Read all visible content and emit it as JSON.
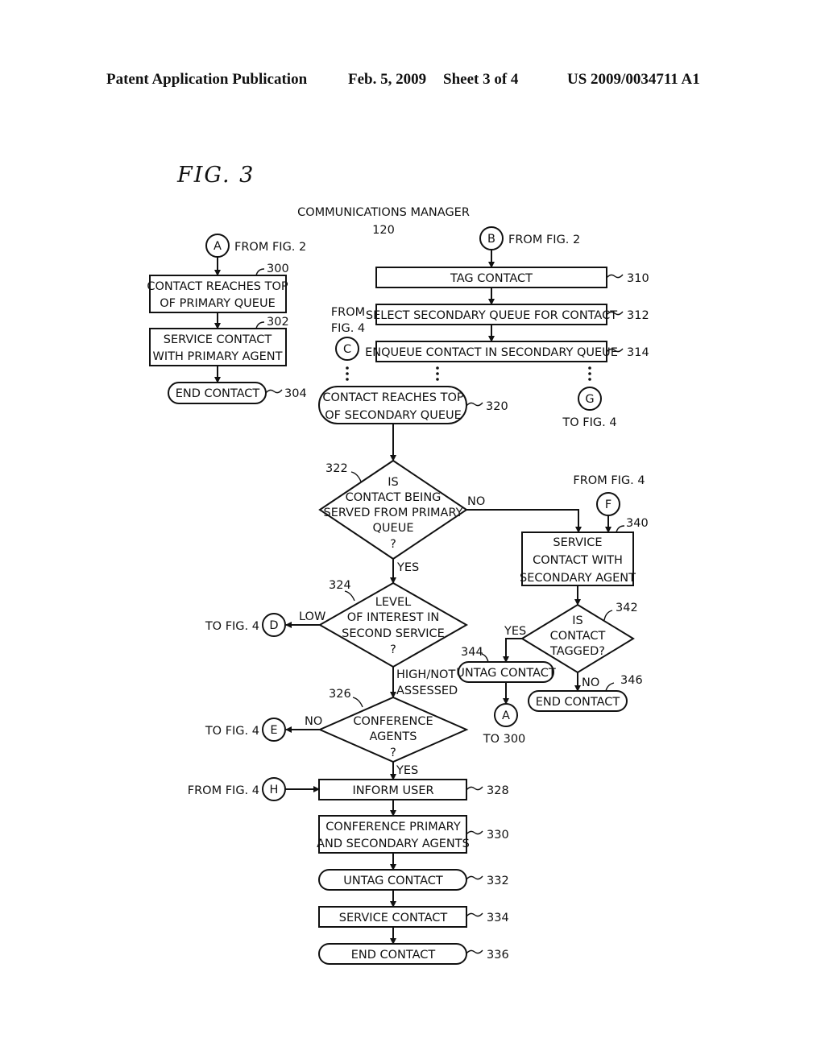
{
  "header": {
    "publication": "Patent Application Publication",
    "date": "Feb. 5, 2009",
    "sheet": "Sheet 3 of 4",
    "patent_number": "US 2009/0034711 A1"
  },
  "figure": {
    "title": "FIG.  3",
    "subtitle_line1": "COMMUNICATIONS MANAGER",
    "subtitle_line2": "120"
  },
  "connectors": {
    "A_top": {
      "letter": "A",
      "label": "FROM FIG. 2"
    },
    "B": {
      "letter": "B",
      "label": "FROM FIG. 2"
    },
    "C": {
      "letter": "C",
      "label_line1": "FROM",
      "label_line2": "FIG. 4"
    },
    "G": {
      "letter": "G",
      "label": "TO FIG. 4"
    },
    "F": {
      "letter": "F",
      "label": "FROM FIG. 4"
    },
    "D": {
      "letter": "D",
      "label": "TO FIG. 4"
    },
    "E": {
      "letter": "E",
      "label": "TO FIG. 4"
    },
    "H": {
      "letter": "H",
      "label": "FROM FIG. 4"
    },
    "A_bottom": {
      "letter": "A",
      "label": "TO 300"
    }
  },
  "steps": {
    "s300": {
      "ref": "300",
      "line1": "CONTACT REACHES TOP",
      "line2": "OF PRIMARY QUEUE"
    },
    "s302": {
      "ref": "302",
      "line1": "SERVICE CONTACT",
      "line2": "WITH PRIMARY AGENT"
    },
    "s304": {
      "ref": "304",
      "line1": "END CONTACT"
    },
    "s310": {
      "ref": "310",
      "line1": "TAG CONTACT"
    },
    "s312": {
      "ref": "312",
      "line1": "SELECT SECONDARY QUEUE FOR CONTACT"
    },
    "s314": {
      "ref": "314",
      "line1": "ENQUEUE CONTACT IN SECONDARY QUEUE"
    },
    "s320": {
      "ref": "320",
      "line1": "CONTACT REACHES TOP",
      "line2": "OF SECONDARY QUEUE"
    },
    "s322": {
      "ref": "322",
      "line1": "IS",
      "line2": "CONTACT BEING",
      "line3": "SERVED FROM PRIMARY",
      "line4": "QUEUE",
      "line5": "?"
    },
    "s324": {
      "ref": "324",
      "line1": "LEVEL",
      "line2": "OF INTEREST IN",
      "line3": "SECOND SERVICE",
      "line4": "?"
    },
    "s326": {
      "ref": "326",
      "line1": "CONFERENCE",
      "line2": "AGENTS",
      "line3": "?"
    },
    "s328": {
      "ref": "328",
      "line1": "INFORM USER"
    },
    "s330": {
      "ref": "330",
      "line1": "CONFERENCE PRIMARY",
      "line2": "AND SECONDARY AGENTS"
    },
    "s332": {
      "ref": "332",
      "line1": "UNTAG CONTACT"
    },
    "s334": {
      "ref": "334",
      "line1": "SERVICE CONTACT"
    },
    "s336": {
      "ref": "336",
      "line1": "END CONTACT"
    },
    "s340": {
      "ref": "340",
      "line1": "SERVICE",
      "line2": "CONTACT WITH",
      "line3": "SECONDARY AGENT"
    },
    "s342": {
      "ref": "342",
      "line1": "IS",
      "line2": "CONTACT",
      "line3": "TAGGED?"
    },
    "s344": {
      "ref": "344",
      "line1": "UNTAG CONTACT"
    },
    "s346": {
      "ref": "346",
      "line1": "END CONTACT"
    }
  },
  "edge_labels": {
    "no_322": "NO",
    "yes_322": "YES",
    "low_324": "LOW",
    "high_324_line1": "HIGH/NOT",
    "high_324_line2": "ASSESSED",
    "no_326": "NO",
    "yes_326": "YES",
    "yes_342": "YES",
    "no_342": "NO"
  }
}
